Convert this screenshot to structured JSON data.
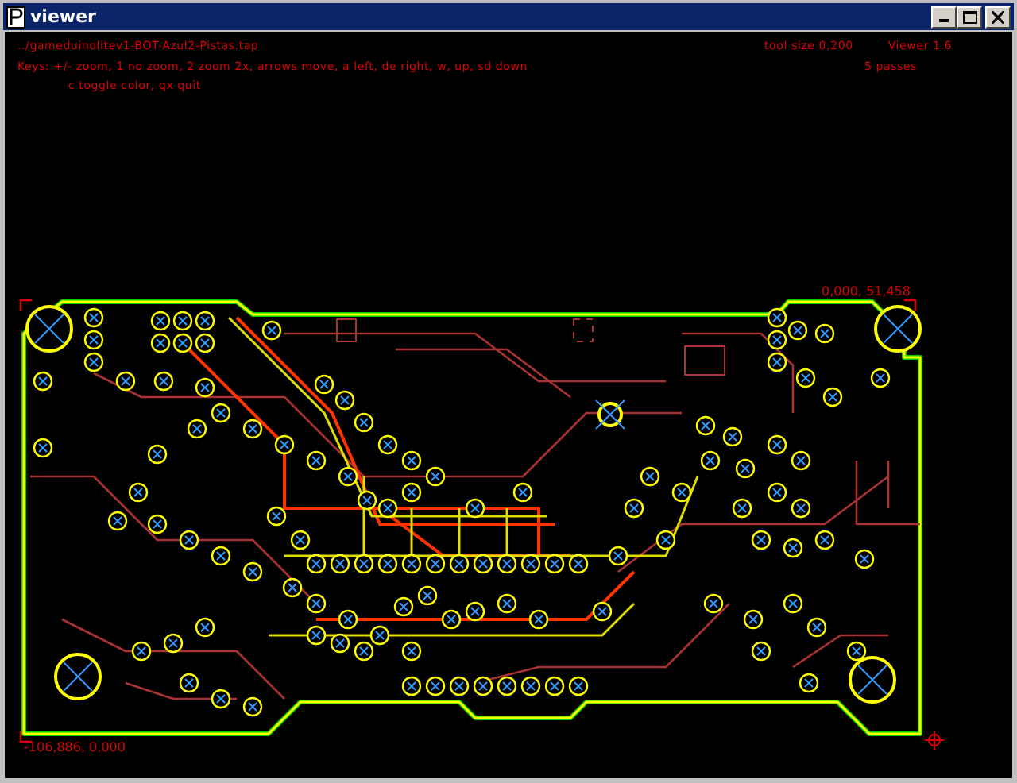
{
  "window": {
    "title": "viewer"
  },
  "header": {
    "file": "../gameduinolitev1-BOT-Azul2-Pistas.tap",
    "tool_size": "tool size  0,200",
    "version": "Viewer 1.6",
    "keys_line_1": "Keys: +/- zoom, 1 no zoom, 2 zoom 2x, arrows move, a left, de right, w, up, sd down",
    "keys_line_2": "c toggle color, qx quit",
    "passes": "5 passes"
  },
  "canvas": {
    "top_right_coords": "0,000, 51,458",
    "bottom_left_coords": "-106,886, 0,000"
  }
}
